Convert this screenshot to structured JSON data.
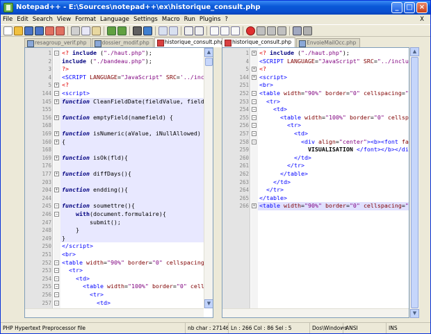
{
  "window": {
    "title": "Notepad++ - E:\\Sources\\notepad++\\ex\\historique_consult.php",
    "close_menu": "X"
  },
  "menu": [
    "File",
    "Edit",
    "Search",
    "View",
    "Format",
    "Language",
    "Settings",
    "Macro",
    "Run",
    "Plugins",
    "?"
  ],
  "left_tabs": [
    {
      "label": "resagroup_verif.php",
      "active": false
    },
    {
      "label": "dossier_modif.php",
      "active": false
    },
    {
      "label": "historique_consult.php",
      "active": true
    }
  ],
  "right_tabs": [
    {
      "label": "historique_consult.php",
      "active": true
    },
    {
      "label": "EnvoieMailOcc.php",
      "active": false
    }
  ],
  "left_lines": [
    {
      "n": "1",
      "f": "box",
      "html": "<span class='php'>&lt;?</span> <span class='kw'>include</span> (<span class='str'>\"./haut.php\"</span>);"
    },
    {
      "n": "2",
      "f": "",
      "html": "<span class='kw'>include</span> (<span class='str'>\"./bandeau.php\"</span>);"
    },
    {
      "n": "3",
      "f": "",
      "html": "<span class='php'>?&gt;</span>"
    },
    {
      "n": "4",
      "f": "",
      "html": "<span class='tag'>&lt;SCRIPT</span> <span class='attr'>LANGUAGE</span>=<span class='str'>\"JavaScript\"</span> <span class='attr'>SRC</span>=<span class='str'>'../inc</span>"
    },
    {
      "n": "5",
      "f": "plus",
      "html": "<span class='php'>&lt;?</span>"
    },
    {
      "n": "144",
      "f": "box",
      "html": "<span class='tag'>&lt;script&gt;</span>"
    },
    {
      "n": "145",
      "f": "plus",
      "hl": true,
      "html": "<span class='kw'><i>function</i></span> CleanFieldDate(fieldValue, field"
    },
    {
      "n": "155",
      "f": "",
      "hl": true,
      "html": ""
    },
    {
      "n": "156",
      "f": "plus",
      "hl": true,
      "html": "<span class='kw'><i>function</i></span> emptyField(namefield) {"
    },
    {
      "n": "168",
      "f": "",
      "hl": true,
      "html": ""
    },
    {
      "n": "169",
      "f": "plus",
      "hl": true,
      "html": "<span class='kw'><i>function</i></span> isNumeric(aValue, iNullAllowed)"
    },
    {
      "n": "160",
      "f": "plus",
      "hl": true,
      "html": "{"
    },
    {
      "n": "168",
      "f": "",
      "hl": true,
      "html": ""
    },
    {
      "n": "169",
      "f": "plus",
      "hl": true,
      "html": "<span class='kw'><i>function</i></span> isOk(fld){"
    },
    {
      "n": "176",
      "f": "",
      "hl": true,
      "html": ""
    },
    {
      "n": "177",
      "f": "plus",
      "hl": true,
      "html": "<span class='kw'><i>function</i></span> diffDays(){"
    },
    {
      "n": "203",
      "f": "",
      "hl": true,
      "html": ""
    },
    {
      "n": "204",
      "f": "plus",
      "hl": true,
      "html": "<span class='kw'><i>function</i></span> endding(){"
    },
    {
      "n": "244",
      "f": "",
      "hl": true,
      "html": ""
    },
    {
      "n": "245",
      "f": "box",
      "hl": true,
      "html": "<span class='kw'><i>function</i></span> soumettre(){"
    },
    {
      "n": "246",
      "f": "box",
      "hl": true,
      "html": "    <span class='kw'>with</span>(document.formulaire){"
    },
    {
      "n": "247",
      "f": "",
      "hl": true,
      "html": "        submit();"
    },
    {
      "n": "248",
      "f": "",
      "hl": true,
      "html": "    }"
    },
    {
      "n": "249",
      "f": "",
      "hl": true,
      "html": "}"
    },
    {
      "n": "250",
      "f": "",
      "html": "<span class='tag'>&lt;/script&gt;</span>"
    },
    {
      "n": "251",
      "f": "",
      "html": "<span class='tag'>&lt;br&gt;</span>"
    },
    {
      "n": "252",
      "f": "box",
      "html": "<span class='tag'>&lt;table</span> <span class='attr'>width</span>=<span class='str'>\"90%\"</span> <span class='attr'>border</span>=<span class='str'>\"0\"</span> <span class='attr'>cellspacing</span>"
    },
    {
      "n": "253",
      "f": "box",
      "html": "  <span class='tag'>&lt;tr&gt;</span>"
    },
    {
      "n": "254",
      "f": "box",
      "html": "    <span class='tag'>&lt;td&gt;</span>"
    },
    {
      "n": "255",
      "f": "box",
      "html": "      <span class='tag'>&lt;table</span> <span class='attr'>width</span>=<span class='str'>\"100%\"</span> <span class='attr'>border</span>=<span class='str'>\"0\"</span> <span class='attr'>cell</span>"
    },
    {
      "n": "256",
      "f": "box",
      "html": "        <span class='tag'>&lt;tr&gt;</span>"
    },
    {
      "n": "257",
      "f": "box",
      "html": "          <span class='tag'>&lt;td&gt;</span>"
    },
    {
      "n": "258",
      "f": "box",
      "html": "            <span class='tag'>&lt;div</span> <span class='attr'>align</span>=<span class='str'>\"center\"</span><span class='tag'>&gt;&lt;b&gt;&lt;font</span>"
    },
    {
      "n": "259",
      "f": "",
      "html": "              <b>VISUALISATION</b> <span class='tag'>&lt;/font&gt;&lt;/b&gt;&lt;/</span>"
    }
  ],
  "right_lines": [
    {
      "n": "1",
      "f": "plus",
      "html": "<span class='php'>&lt;?</span> <span class='kw'>include</span> (<span class='str'>\"./haut.php\"</span>);"
    },
    {
      "n": "4",
      "f": "",
      "html": "<span class='tag'>&lt;SCRIPT</span> <span class='attr'>LANGUAGE</span>=<span class='str'>\"JavaScript\"</span> <span class='attr'>SRC</span>=<span class='str'>\"../inclu</span>"
    },
    {
      "n": "5",
      "f": "plus",
      "html": "<span class='php'>&lt;?</span>"
    },
    {
      "n": "144",
      "f": "plus",
      "html": "<span class='tag'>&lt;script&gt;</span>"
    },
    {
      "n": "251",
      "f": "",
      "html": "<span class='tag'>&lt;br&gt;</span>"
    },
    {
      "n": "252",
      "f": "box",
      "html": "<span class='tag'>&lt;table</span> <span class='attr'>width</span>=<span class='str'>\"90%\"</span> <span class='attr'>border</span>=<span class='str'>\"0\"</span> <span class='attr'>cellspacing</span>=<span class='str'>\"</span>"
    },
    {
      "n": "253",
      "f": "box",
      "html": "  <span class='tag'>&lt;tr&gt;</span>"
    },
    {
      "n": "254",
      "f": "box",
      "html": "    <span class='tag'>&lt;td&gt;</span>"
    },
    {
      "n": "255",
      "f": "box",
      "html": "      <span class='tag'>&lt;table</span> <span class='attr'>width</span>=<span class='str'>\"100%\"</span> <span class='attr'>border</span>=<span class='str'>\"0\"</span> <span class='attr'>cellsp</span>"
    },
    {
      "n": "256",
      "f": "box",
      "html": "        <span class='tag'>&lt;tr&gt;</span>"
    },
    {
      "n": "257",
      "f": "box",
      "html": "          <span class='tag'>&lt;td&gt;</span>"
    },
    {
      "n": "258",
      "f": "box",
      "html": "            <span class='tag'>&lt;div</span> <span class='attr'>align</span>=<span class='str'>\"center\"</span><span class='tag'>&gt;&lt;b&gt;&lt;font</span> <span class='attr'>fa</span>"
    },
    {
      "n": "259",
      "f": "",
      "html": "              <b>VISUALISATION</b> <span class='tag'>&lt;/font&gt;&lt;/b&gt;&lt;/di</span>"
    },
    {
      "n": "260",
      "f": "",
      "html": "          <span class='tag'>&lt;/td&gt;</span>"
    },
    {
      "n": "261",
      "f": "",
      "html": "        <span class='tag'>&lt;/tr&gt;</span>"
    },
    {
      "n": "262",
      "f": "",
      "html": "      <span class='tag'>&lt;/table&gt;</span>"
    },
    {
      "n": "263",
      "f": "",
      "html": "    <span class='tag'>&lt;/td&gt;</span>"
    },
    {
      "n": "264",
      "f": "",
      "html": "  <span class='tag'>&lt;/tr&gt;</span>"
    },
    {
      "n": "265",
      "f": "",
      "html": "<span class='tag'>&lt;/table&gt;</span>"
    },
    {
      "n": "266",
      "f": "plus",
      "sel": true,
      "html": "<span class='tag'>&lt;table</span> <span class='attr'>width</span>=<span class='str'>\"90%\"</span> <span class='attr'>border</span>=<span class='str'>\"0\"</span> <span class='attr'>cellspacing</span>=<span class='str'>\"</span>"
    }
  ],
  "status": {
    "filetype": "PHP Hypertext Preprocessor file",
    "nbchar": "nb char : 27146",
    "position": "Ln : 266   Col : 86   Sel : 5",
    "eol": "Dos\\Windows",
    "encoding": "ANSI",
    "mode": "INS"
  },
  "colors": {
    "titlebar": "#0a58d8",
    "keyword": "#00007f",
    "tag": "#0000ff",
    "string": "#7f007f",
    "php": "#e00000"
  }
}
